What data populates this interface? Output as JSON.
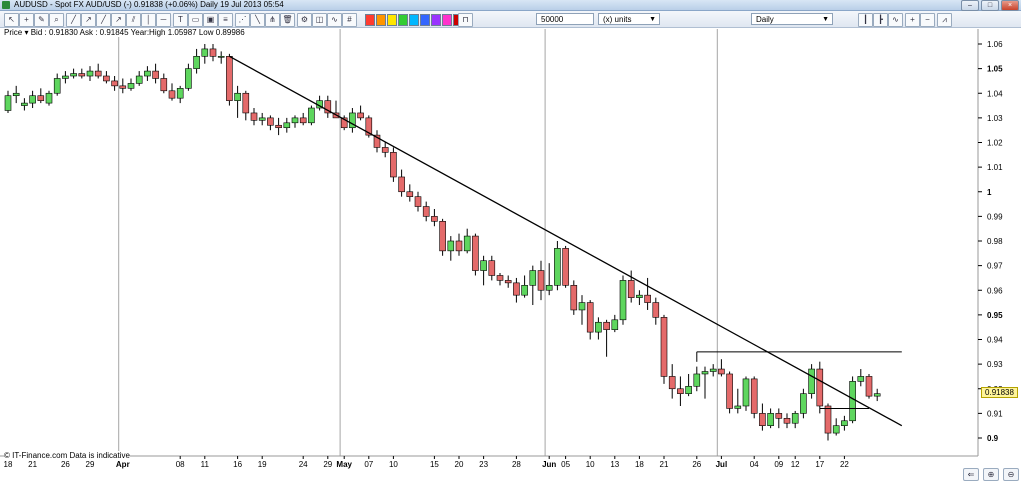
{
  "window": {
    "title": "AUDUSD - Spot FX AUD/USD (-)    0.91838 (+0.06%)    Daily   19 Jul 2013 05:54"
  },
  "toolbar": {
    "quantity_value": "50000",
    "units_value": "(x) units",
    "period_value": "Daily",
    "tools": [
      "pointer-icon",
      "crosshair-icon",
      "pencil-icon",
      "line-icon",
      "line-icon",
      "hline-icon",
      "vline-icon",
      "channel-icon",
      "fib-icon",
      "text-icon",
      "trash-icon"
    ],
    "swatch_colors": [
      "#ff3b30",
      "#ff9500",
      "#ffe600",
      "#33cc33",
      "#00b7ff",
      "#3366ff",
      "#9933ff",
      "#ff33cc",
      "#cc0000"
    ]
  },
  "info": {
    "price_label": "Price",
    "quote": "Bid : 0.91830  Ask : 0.91845  Year:High 1.05987  Low 0.89986"
  },
  "watermark": "© IT-Finance.com  Data is indicative",
  "last_price": "0.91838",
  "colors": {
    "bull": "#5ed65e",
    "bear": "#e46a6a",
    "grid": "#a5a5a5",
    "line": "#000000",
    "tag": "#fff59a"
  },
  "chart_data": {
    "type": "candlestick",
    "title": "AUDUSD - Spot FX AUD/USD (-)",
    "ylim": [
      0.895,
      1.065
    ],
    "yticks": [
      0.9,
      0.91,
      0.92,
      0.93,
      0.94,
      0.95,
      0.96,
      0.97,
      0.98,
      0.99,
      1.0,
      1.01,
      1.02,
      1.03,
      1.04,
      1.05,
      1.06
    ],
    "ytick_labels": [
      "0.9",
      "0.91",
      "0.92",
      "0.93",
      "0.94",
      "0.95",
      "0.96",
      "0.97",
      "0.98",
      "0.99",
      "1",
      "1.01",
      "1.02",
      "1.03",
      "1.04",
      "1.05",
      "1.06"
    ],
    "bold_yticks": [
      "0.9",
      "0.95",
      "1",
      "1.05"
    ],
    "x_labels": [
      "18",
      "21",
      "26",
      "29",
      "Apr",
      "08",
      "11",
      "16",
      "19",
      "24",
      "29",
      "May",
      "07",
      "10",
      "15",
      "20",
      "23",
      "28",
      "Jun",
      "05",
      "10",
      "13",
      "18",
      "21",
      "26",
      "Jul",
      "04",
      "09",
      "12",
      "17",
      "22"
    ],
    "x_label_index": [
      0,
      3,
      7,
      10,
      14,
      21,
      24,
      28,
      31,
      36,
      39,
      41,
      44,
      47,
      52,
      55,
      58,
      62,
      66,
      68,
      71,
      74,
      77,
      80,
      84,
      87,
      91,
      94,
      96,
      99,
      102
    ],
    "month_labels": [
      "Apr",
      "May",
      "Jun",
      "Jul"
    ],
    "month_line_index": [
      14,
      41,
      66,
      87
    ],
    "candles": [
      [
        1.033,
        1.041,
        1.032,
        1.039
      ],
      [
        1.039,
        1.043,
        1.036,
        1.04
      ],
      [
        1.035,
        1.038,
        1.033,
        1.036
      ],
      [
        1.036,
        1.041,
        1.034,
        1.039
      ],
      [
        1.039,
        1.042,
        1.036,
        1.037
      ],
      [
        1.036,
        1.041,
        1.035,
        1.04
      ],
      [
        1.04,
        1.048,
        1.039,
        1.046
      ],
      [
        1.046,
        1.049,
        1.044,
        1.047
      ],
      [
        1.047,
        1.05,
        1.046,
        1.048
      ],
      [
        1.048,
        1.05,
        1.046,
        1.047
      ],
      [
        1.047,
        1.051,
        1.045,
        1.049
      ],
      [
        1.049,
        1.052,
        1.046,
        1.047
      ],
      [
        1.047,
        1.049,
        1.044,
        1.045
      ],
      [
        1.045,
        1.047,
        1.041,
        1.043
      ],
      [
        1.043,
        1.046,
        1.04,
        1.042
      ],
      [
        1.042,
        1.046,
        1.041,
        1.044
      ],
      [
        1.044,
        1.049,
        1.043,
        1.047
      ],
      [
        1.047,
        1.051,
        1.045,
        1.049
      ],
      [
        1.049,
        1.052,
        1.044,
        1.046
      ],
      [
        1.046,
        1.048,
        1.04,
        1.041
      ],
      [
        1.041,
        1.044,
        1.037,
        1.038
      ],
      [
        1.038,
        1.043,
        1.036,
        1.042
      ],
      [
        1.042,
        1.052,
        1.041,
        1.05
      ],
      [
        1.05,
        1.058,
        1.048,
        1.055
      ],
      [
        1.055,
        1.06,
        1.052,
        1.058
      ],
      [
        1.058,
        1.06,
        1.053,
        1.055
      ],
      [
        1.055,
        1.057,
        1.052,
        1.055
      ],
      [
        1.055,
        1.056,
        1.035,
        1.037
      ],
      [
        1.037,
        1.043,
        1.03,
        1.04
      ],
      [
        1.04,
        1.041,
        1.029,
        1.032
      ],
      [
        1.032,
        1.034,
        1.027,
        1.029
      ],
      [
        1.029,
        1.032,
        1.027,
        1.03
      ],
      [
        1.03,
        1.031,
        1.025,
        1.027
      ],
      [
        1.027,
        1.03,
        1.023,
        1.026
      ],
      [
        1.026,
        1.03,
        1.024,
        1.028
      ],
      [
        1.028,
        1.031,
        1.026,
        1.03
      ],
      [
        1.03,
        1.032,
        1.027,
        1.028
      ],
      [
        1.028,
        1.035,
        1.027,
        1.034
      ],
      [
        1.034,
        1.039,
        1.033,
        1.037
      ],
      [
        1.037,
        1.039,
        1.03,
        1.032
      ],
      [
        1.032,
        1.037,
        1.03,
        1.03
      ],
      [
        1.03,
        1.031,
        1.025,
        1.026
      ],
      [
        1.026,
        1.034,
        1.024,
        1.032
      ],
      [
        1.032,
        1.035,
        1.029,
        1.03
      ],
      [
        1.03,
        1.031,
        1.022,
        1.023
      ],
      [
        1.023,
        1.025,
        1.016,
        1.018
      ],
      [
        1.018,
        1.02,
        1.014,
        1.016
      ],
      [
        1.016,
        1.018,
        1.004,
        1.006
      ],
      [
        1.006,
        1.009,
        0.998,
        1.0
      ],
      [
        1.0,
        1.003,
        0.996,
        0.998
      ],
      [
        0.998,
        1.0,
        0.992,
        0.994
      ],
      [
        0.994,
        0.996,
        0.988,
        0.99
      ],
      [
        0.99,
        0.993,
        0.986,
        0.988
      ],
      [
        0.988,
        0.989,
        0.974,
        0.976
      ],
      [
        0.976,
        0.982,
        0.972,
        0.98
      ],
      [
        0.98,
        0.983,
        0.974,
        0.976
      ],
      [
        0.976,
        0.985,
        0.975,
        0.982
      ],
      [
        0.982,
        0.983,
        0.966,
        0.968
      ],
      [
        0.968,
        0.974,
        0.962,
        0.972
      ],
      [
        0.972,
        0.974,
        0.964,
        0.966
      ],
      [
        0.966,
        0.967,
        0.962,
        0.964
      ],
      [
        0.964,
        0.966,
        0.961,
        0.963
      ],
      [
        0.963,
        0.965,
        0.955,
        0.958
      ],
      [
        0.958,
        0.966,
        0.957,
        0.962
      ],
      [
        0.962,
        0.97,
        0.954,
        0.968
      ],
      [
        0.968,
        0.972,
        0.956,
        0.96
      ],
      [
        0.96,
        0.971,
        0.958,
        0.962
      ],
      [
        0.962,
        0.98,
        0.96,
        0.977
      ],
      [
        0.977,
        0.978,
        0.961,
        0.962
      ],
      [
        0.962,
        0.964,
        0.95,
        0.952
      ],
      [
        0.952,
        0.958,
        0.946,
        0.955
      ],
      [
        0.955,
        0.956,
        0.94,
        0.943
      ],
      [
        0.943,
        0.949,
        0.94,
        0.947
      ],
      [
        0.947,
        0.948,
        0.933,
        0.944
      ],
      [
        0.944,
        0.95,
        0.943,
        0.948
      ],
      [
        0.948,
        0.966,
        0.946,
        0.964
      ],
      [
        0.964,
        0.968,
        0.955,
        0.957
      ],
      [
        0.957,
        0.96,
        0.954,
        0.958
      ],
      [
        0.958,
        0.965,
        0.952,
        0.955
      ],
      [
        0.955,
        0.957,
        0.946,
        0.949
      ],
      [
        0.949,
        0.95,
        0.922,
        0.925
      ],
      [
        0.925,
        0.93,
        0.916,
        0.92
      ],
      [
        0.92,
        0.925,
        0.913,
        0.918
      ],
      [
        0.918,
        0.926,
        0.917,
        0.921
      ],
      [
        0.921,
        0.929,
        0.919,
        0.926
      ],
      [
        0.926,
        0.929,
        0.916,
        0.927
      ],
      [
        0.927,
        0.93,
        0.925,
        0.928
      ],
      [
        0.928,
        0.932,
        0.925,
        0.926
      ],
      [
        0.926,
        0.927,
        0.91,
        0.912
      ],
      [
        0.912,
        0.92,
        0.91,
        0.913
      ],
      [
        0.913,
        0.925,
        0.911,
        0.924
      ],
      [
        0.924,
        0.925,
        0.908,
        0.91
      ],
      [
        0.91,
        0.914,
        0.903,
        0.905
      ],
      [
        0.905,
        0.912,
        0.904,
        0.91
      ],
      [
        0.91,
        0.912,
        0.904,
        0.908
      ],
      [
        0.908,
        0.91,
        0.904,
        0.906
      ],
      [
        0.906,
        0.911,
        0.904,
        0.91
      ],
      [
        0.91,
        0.92,
        0.908,
        0.918
      ],
      [
        0.918,
        0.93,
        0.916,
        0.928
      ],
      [
        0.928,
        0.931,
        0.91,
        0.913
      ],
      [
        0.913,
        0.914,
        0.899,
        0.902
      ],
      [
        0.902,
        0.908,
        0.901,
        0.905
      ],
      [
        0.905,
        0.909,
        0.903,
        0.907
      ],
      [
        0.907,
        0.925,
        0.906,
        0.923
      ],
      [
        0.923,
        0.928,
        0.921,
        0.925
      ],
      [
        0.925,
        0.926,
        0.916,
        0.917
      ],
      [
        0.917,
        0.92,
        0.915,
        0.918
      ]
    ],
    "trendline": {
      "from": [
        27,
        1.055
      ],
      "to": [
        109,
        0.905
      ]
    },
    "horizontal_lines": [
      {
        "from": [
          84,
          0.935
        ],
        "to": [
          109,
          0.935
        ]
      },
      {
        "from": [
          99,
          0.912
        ],
        "to": [
          105,
          0.912
        ]
      }
    ],
    "grid": "vertical month lines only",
    "last_price": 0.91838
  }
}
